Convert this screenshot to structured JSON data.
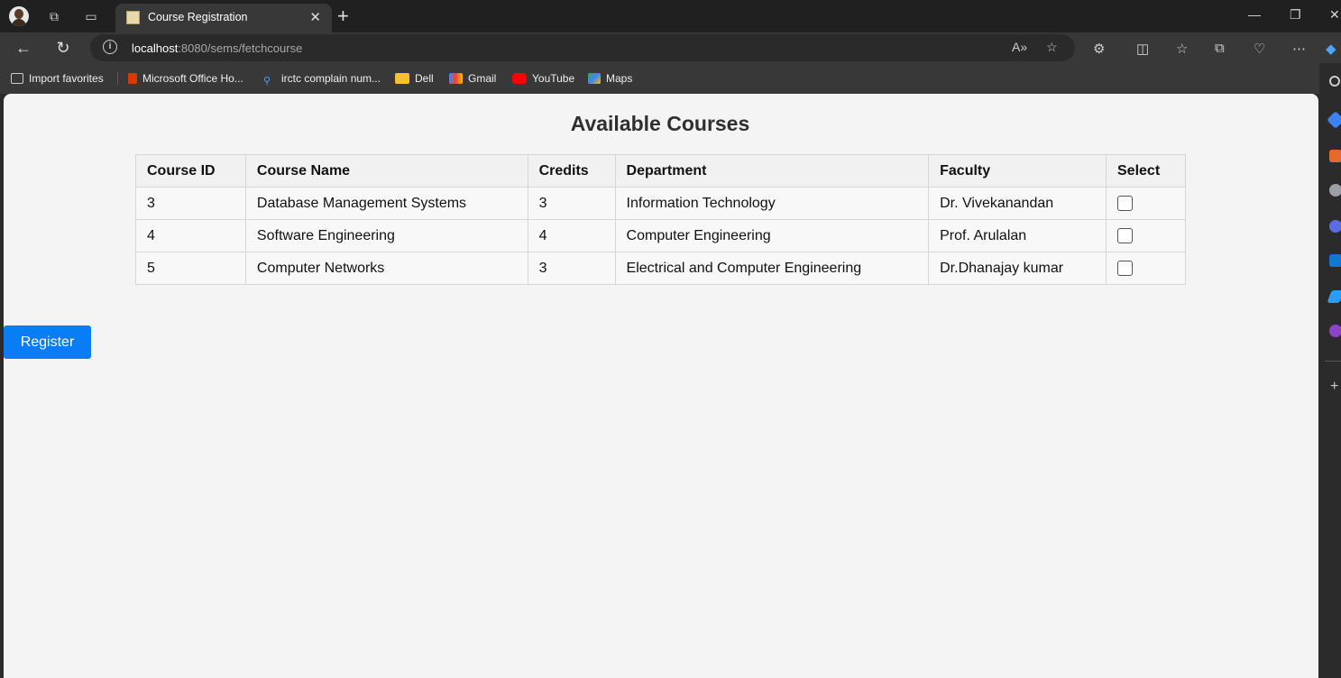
{
  "browser": {
    "tab_title": "Course Registration",
    "url_host": "localhost",
    "url_rest": ":8080/sems/fetchcourse",
    "bookmarks": [
      {
        "label": "Import favorites",
        "icon": "import-icon"
      },
      {
        "label": "Microsoft Office Ho...",
        "icon": "office-icon"
      },
      {
        "label": "irctc complain num...",
        "icon": "search-icon"
      },
      {
        "label": "Dell",
        "icon": "folder-icon"
      },
      {
        "label": "Gmail",
        "icon": "gmail-icon"
      },
      {
        "label": "YouTube",
        "icon": "youtube-icon"
      },
      {
        "label": "Maps",
        "icon": "maps-icon"
      }
    ]
  },
  "page": {
    "title": "Available Courses",
    "columns": [
      "Course ID",
      "Course Name",
      "Credits",
      "Department",
      "Faculty",
      "Select"
    ],
    "rows": [
      {
        "id": "3",
        "name": "Database Management Systems",
        "credits": "3",
        "department": "Information Technology",
        "faculty": "Dr. Vivekanandan",
        "selected": false
      },
      {
        "id": "4",
        "name": "Software Engineering",
        "credits": "4",
        "department": "Computer Engineering",
        "faculty": "Prof. Arulalan",
        "selected": false
      },
      {
        "id": "5",
        "name": "Computer Networks",
        "credits": "3",
        "department": "Electrical and Computer Engineering",
        "faculty": "Dr.Dhanajay kumar",
        "selected": false
      }
    ],
    "register_label": "Register",
    "accent_color": "#0a7cf5"
  }
}
